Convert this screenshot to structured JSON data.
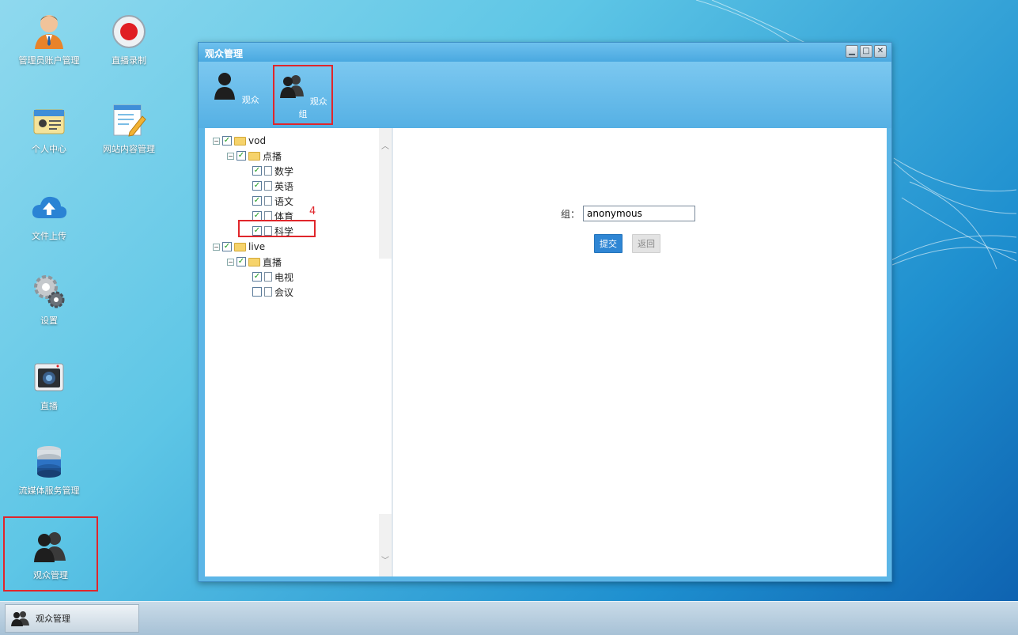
{
  "desktop": {
    "icons": [
      {
        "label": "管理员账户管理"
      },
      {
        "label": "直播录制"
      },
      {
        "label": "个人中心"
      },
      {
        "label": "网站内容管理"
      },
      {
        "label": "文件上传"
      },
      {
        "label": "设置"
      },
      {
        "label": "直播"
      },
      {
        "label": "流媒体服务管理"
      },
      {
        "label": "观众管理"
      }
    ]
  },
  "window": {
    "title": "观众管理",
    "toolbar": {
      "tabs": [
        {
          "label": "观众"
        },
        {
          "label": "观众组"
        }
      ]
    },
    "tree": {
      "nodes": [
        {
          "label": "vod",
          "checked": true,
          "expanded": true
        },
        {
          "label": "点播",
          "checked": true,
          "expanded": true
        },
        {
          "label": "数学",
          "checked": true
        },
        {
          "label": "英语",
          "checked": true
        },
        {
          "label": "语文",
          "checked": true
        },
        {
          "label": "体育",
          "checked": true
        },
        {
          "label": "科学",
          "checked": true
        },
        {
          "label": "live",
          "checked": true,
          "expanded": true
        },
        {
          "label": "直播",
          "checked": true,
          "expanded": true
        },
        {
          "label": "电视",
          "checked": true
        },
        {
          "label": "会议",
          "checked": false
        }
      ],
      "annotation": "4"
    },
    "form": {
      "group_label": "组：",
      "group_value": "anonymous",
      "submit_label": "提交",
      "back_label": "返回"
    }
  },
  "taskbar": {
    "active_task": "观众管理"
  },
  "colors": {
    "highlight": "#e0262b",
    "primary_button": "#2f86d4",
    "window_chrome": "#5cb6e7"
  }
}
